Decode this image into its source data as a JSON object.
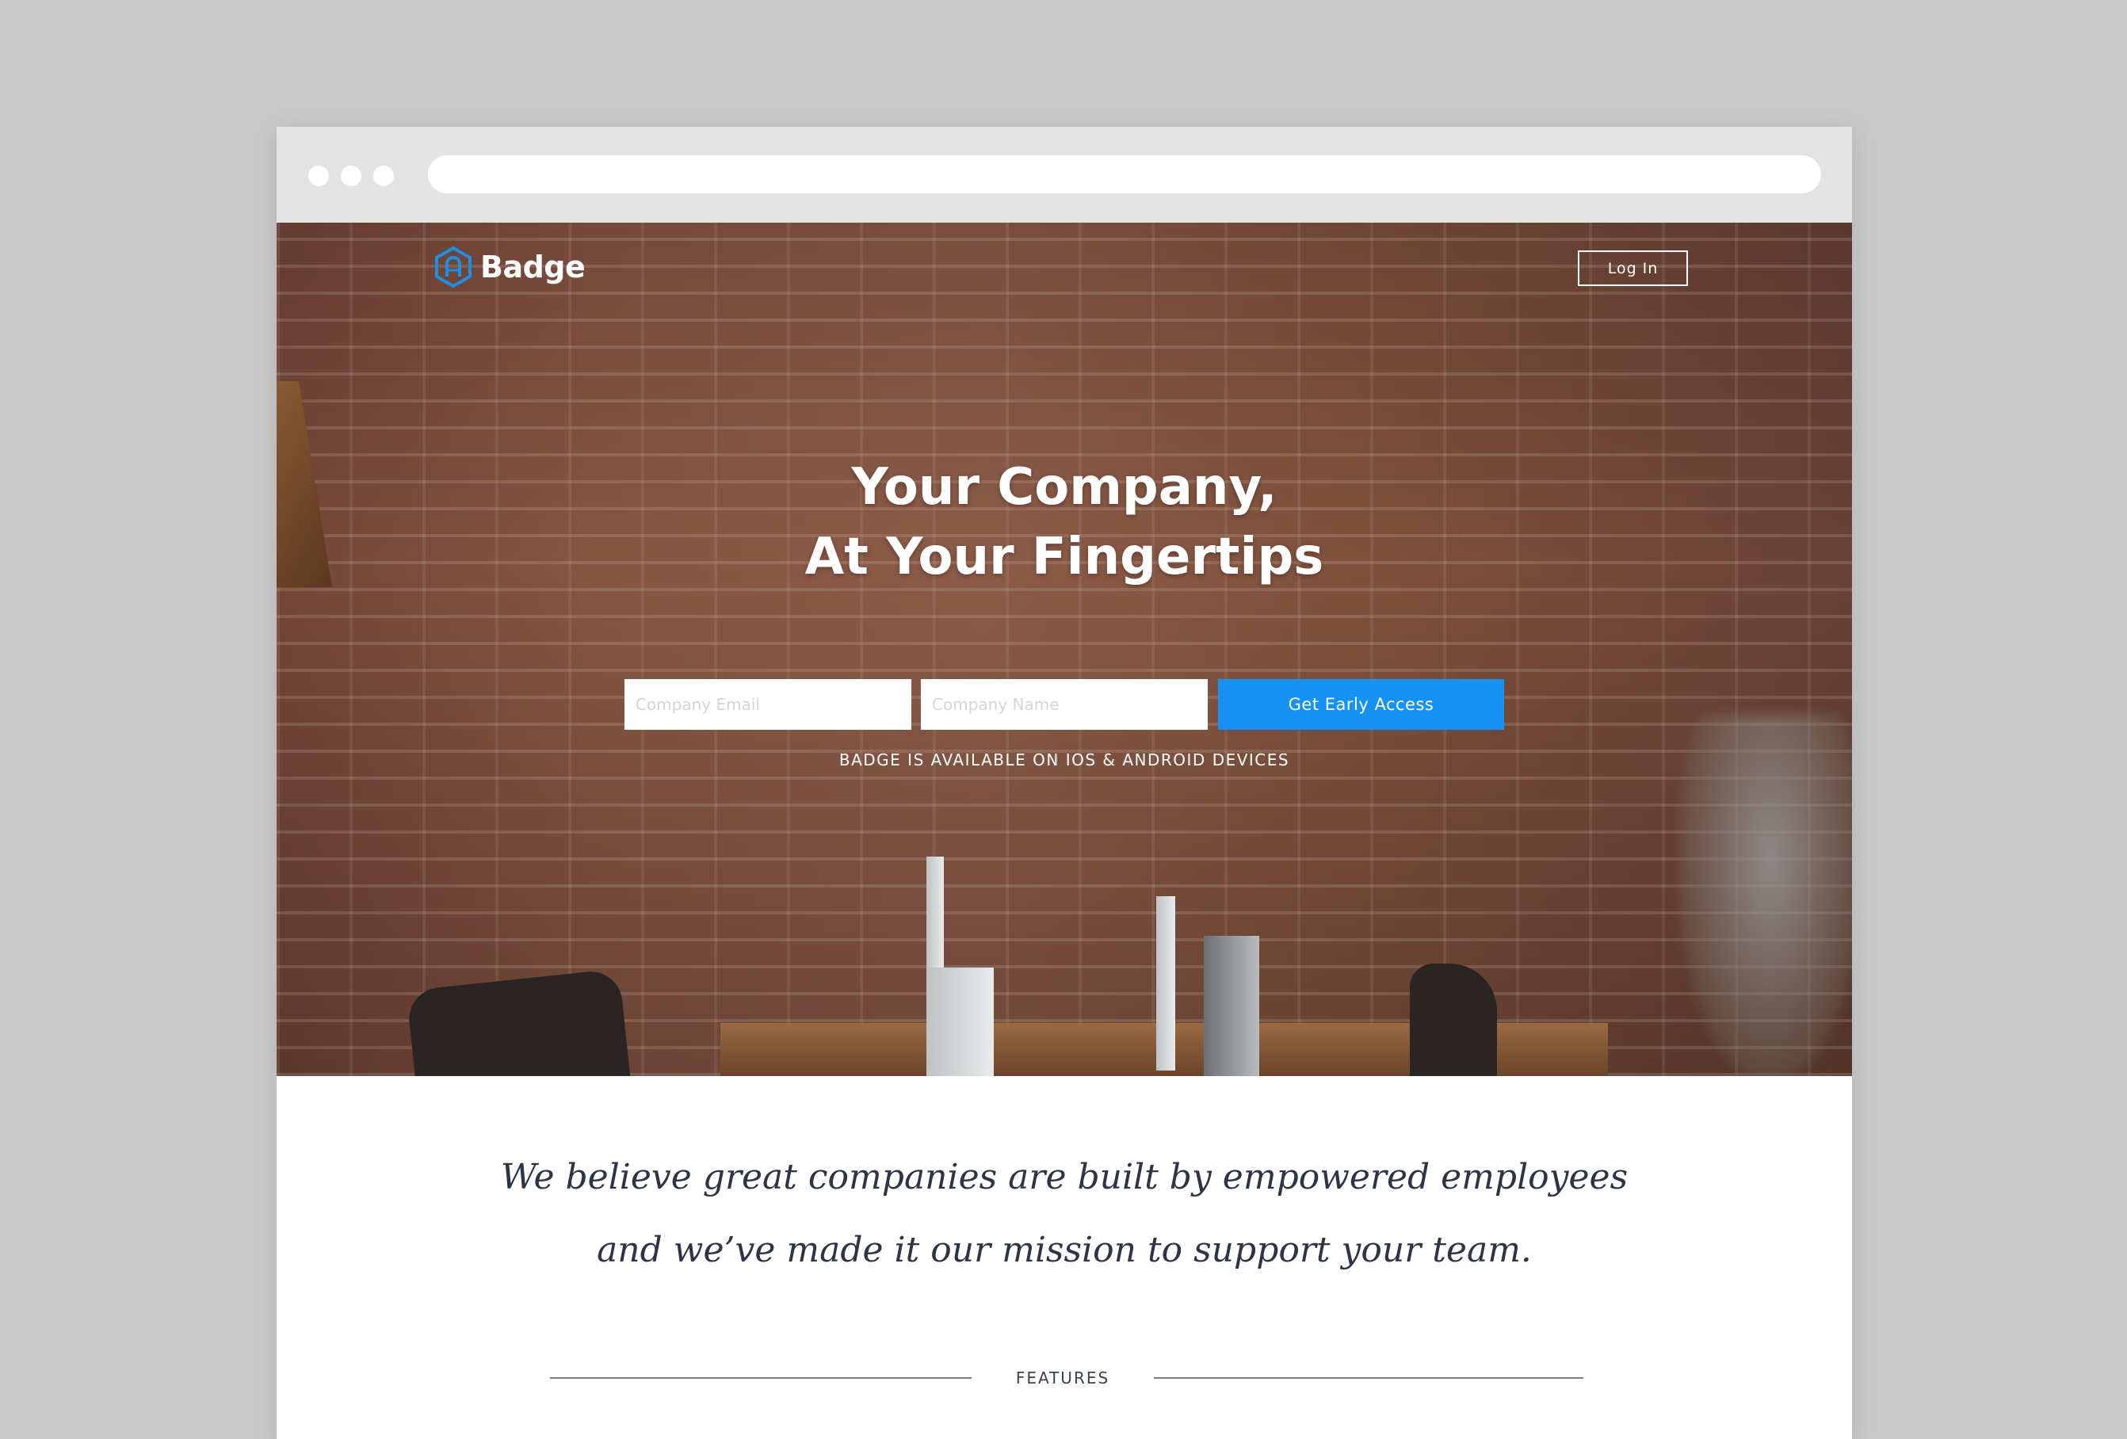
{
  "site": {
    "brand_name": "Badge",
    "login_label": "Log In"
  },
  "hero": {
    "headline_line1": "Your Company,",
    "headline_line2": "At Your Fingertips",
    "email_placeholder": "Company Email",
    "company_placeholder": "Company Name",
    "cta_label": "Get Early Access",
    "availability_text": "BADGE IS AVAILABLE ON IOS & ANDROID DEVICES"
  },
  "mission": {
    "line1": "We believe great companies are built by empowered employees",
    "line2": "and we’ve made it our mission to support your team."
  },
  "section": {
    "features_label": "FEATURES"
  },
  "colors": {
    "cta_blue": "#1691f4",
    "logo_blue": "#1d8fe8",
    "text_dark": "#2c3446",
    "backdrop": "#c9c9c9",
    "chrome": "#e3e3e3"
  },
  "icons": {
    "logo": "badge-hexagon-logo-icon"
  }
}
